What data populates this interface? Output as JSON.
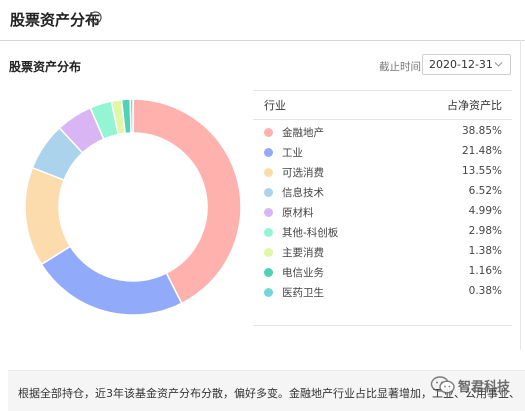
{
  "header": {
    "title": "股票资产分布"
  },
  "section": {
    "title": "股票资产分布"
  },
  "date_filter": {
    "label": "截止时间",
    "value": "2020-12-31"
  },
  "table": {
    "col_industry": "行业",
    "col_ratio": "占净资产比",
    "rows": [
      {
        "label": "金融地产",
        "value": "38.85%",
        "color": "#ffb1ad"
      },
      {
        "label": "工业",
        "value": "21.48%",
        "color": "#91aafa"
      },
      {
        "label": "可选消费",
        "value": "13.55%",
        "color": "#fcdcad"
      },
      {
        "label": "信息技术",
        "value": "6.52%",
        "color": "#abd3ec"
      },
      {
        "label": "原材料",
        "value": "4.99%",
        "color": "#dab5f3"
      },
      {
        "label": "其他-科创板",
        "value": "2.98%",
        "color": "#93f5d3"
      },
      {
        "label": "主要消费",
        "value": "1.38%",
        "color": "#e1f7a6"
      },
      {
        "label": "电信业务",
        "value": "1.16%",
        "color": "#4fd3b4"
      },
      {
        "label": "医药卫生",
        "value": "0.38%",
        "color": "#76d6d6"
      }
    ]
  },
  "note": {
    "text": "根据全部持仓，近3年该基金资产分布分散，偏好多变。金融地产行业占比显著增加，工业、公用事业、"
  },
  "watermark": {
    "text": "智君科技"
  }
}
